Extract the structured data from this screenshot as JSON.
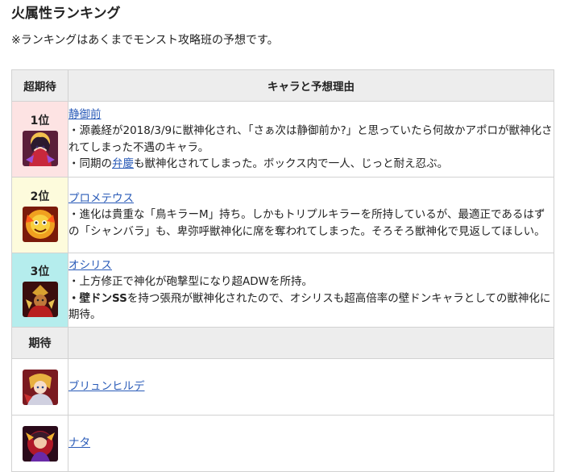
{
  "page": {
    "title": "火属性ランキング",
    "note": "※ランキングはあくまでモンスト攻略班の予想です。"
  },
  "table": {
    "col1_header": "超期待",
    "col2_header": "キャラと予想理由",
    "rows": [
      {
        "rank": "1位",
        "name": "静御前",
        "line1": "・源義経が2018/3/9に獣神化され、「さぁ次は静御前か?」と思っていたら何故かアポロが獣神化されてしまった不遇のキャラ。",
        "line2_pre": "・同期の",
        "line2_link": "弁慶",
        "line2_post": "も獣神化されてしまった。ボックス内で一人、じっと耐え忍ぶ。",
        "bg": "#fde3e3"
      },
      {
        "rank": "2位",
        "name": "プロメテウス",
        "line1": "・進化は貴重な「鳥キラーM」持ち。しかもトリプルキラーを所持しているが、最適正であるはずの「シャンバラ」も、卑弥呼獣神化に席を奪われてしまった。そろそろ獣神化で見返してほしい。",
        "bg": "#fdfbdc"
      },
      {
        "rank": "3位",
        "name": "オシリス",
        "line1": "・上方修正で神化が砲撃型になり超ADWを所持。",
        "line2_bold": "・壁ドンSS",
        "line2_post": "を持つ張飛が獣神化されたので、オシリスも超高倍率の壁ドンキャラとしての獣神化に期待。",
        "bg": "#b5eded"
      }
    ],
    "sub_header": "期待",
    "expect_rows": [
      {
        "name": "ブリュンヒルデ"
      },
      {
        "name": "ナタ"
      }
    ]
  },
  "icons": [
    "shizuka-gozen-icon",
    "prometheus-icon",
    "osiris-icon",
    "brynhildr-icon",
    "nata-icon"
  ]
}
